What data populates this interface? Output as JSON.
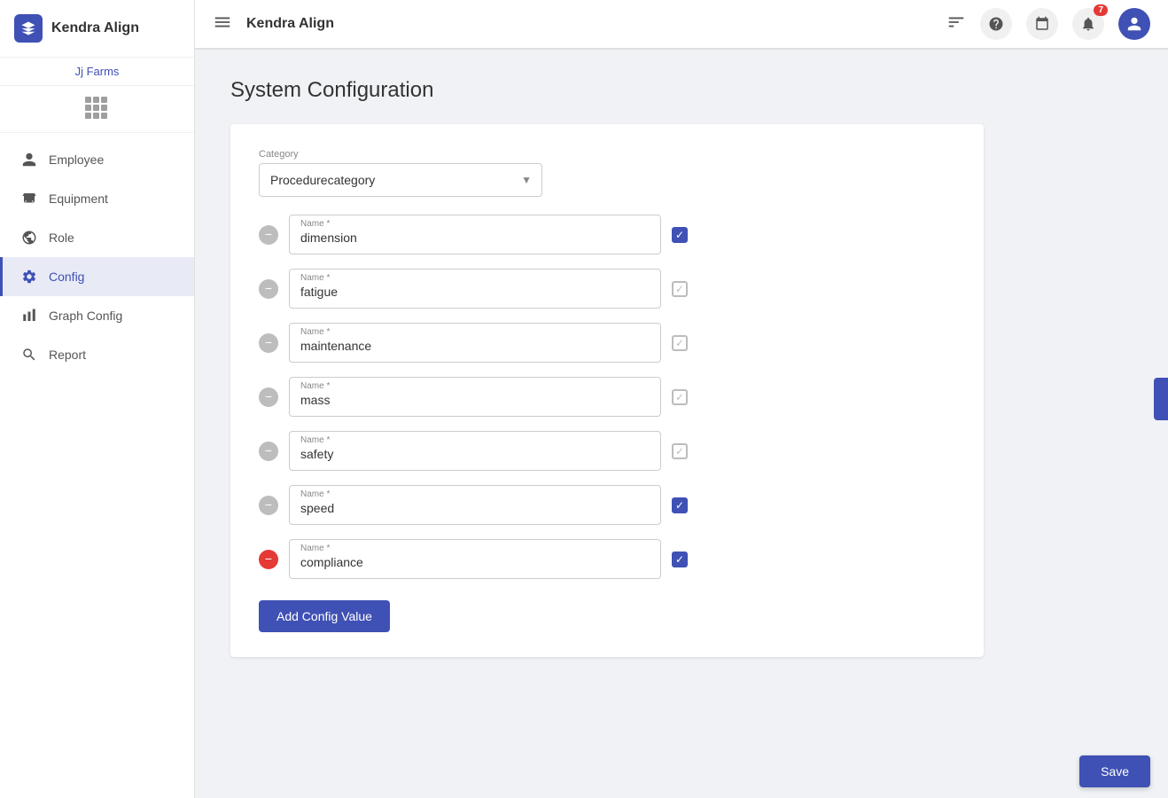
{
  "app": {
    "name": "Kendra Align",
    "org": "Jj Farms"
  },
  "topbar": {
    "title": "Kendra Align"
  },
  "notifications": {
    "count": "7"
  },
  "sidebar": {
    "items": [
      {
        "id": "employee",
        "label": "Employee",
        "icon": "person"
      },
      {
        "id": "equipment",
        "label": "Equipment",
        "icon": "bus"
      },
      {
        "id": "role",
        "label": "Role",
        "icon": "globe"
      },
      {
        "id": "config",
        "label": "Config",
        "icon": "settings",
        "active": true
      },
      {
        "id": "graph-config",
        "label": "Graph Config",
        "icon": "graph"
      },
      {
        "id": "report",
        "label": "Report",
        "icon": "search"
      }
    ]
  },
  "page": {
    "title": "System Configuration"
  },
  "category": {
    "label": "Category",
    "value": "Procedurecategory",
    "options": [
      "Procedurecategory"
    ]
  },
  "config_rows": [
    {
      "id": 1,
      "name": "dimension",
      "checked": true,
      "checkStyle": "blue",
      "removeStyle": "grey"
    },
    {
      "id": 2,
      "name": "fatigue",
      "checked": true,
      "checkStyle": "grey",
      "removeStyle": "grey"
    },
    {
      "id": 3,
      "name": "maintenance",
      "checked": true,
      "checkStyle": "grey",
      "removeStyle": "grey"
    },
    {
      "id": 4,
      "name": "mass",
      "checked": true,
      "checkStyle": "grey",
      "removeStyle": "grey"
    },
    {
      "id": 5,
      "name": "safety",
      "checked": true,
      "checkStyle": "grey",
      "removeStyle": "grey"
    },
    {
      "id": 6,
      "name": "speed",
      "checked": true,
      "checkStyle": "blue",
      "removeStyle": "grey"
    },
    {
      "id": 7,
      "name": "compliance",
      "checked": true,
      "checkStyle": "blue",
      "removeStyle": "red"
    }
  ],
  "buttons": {
    "add_config": "Add Config Value",
    "save": "Save"
  },
  "labels": {
    "name_field": "Name *"
  }
}
